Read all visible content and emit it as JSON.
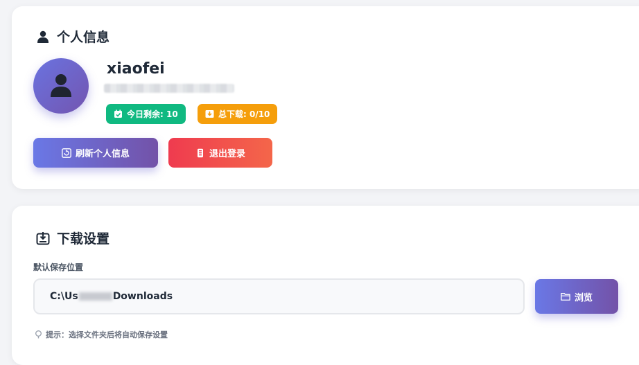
{
  "profile": {
    "title": "个人信息",
    "username": "xiaofei",
    "badge_today": "今日剩余: 10",
    "badge_total": "总下载: 0/10",
    "refresh_label": "刷新个人信息",
    "logout_label": "退出登录"
  },
  "download": {
    "title": "下载设置",
    "field_label": "默认保存位置",
    "path_prefix": "C:\\Us",
    "path_suffix": "Downloads",
    "browse_label": "浏览",
    "hint": "提示：选择文件夹后将自动保存设置"
  },
  "colors": {
    "accent": "#6a78e6",
    "success": "#10b981",
    "warning": "#f59e0b",
    "danger": "#ef3b4f"
  },
  "icons": [
    "user-icon",
    "avatar-user-icon",
    "calendar-icon",
    "download-box-icon",
    "refresh-icon",
    "logout-icon",
    "download-settings-icon",
    "folder-icon",
    "pin-icon"
  ]
}
